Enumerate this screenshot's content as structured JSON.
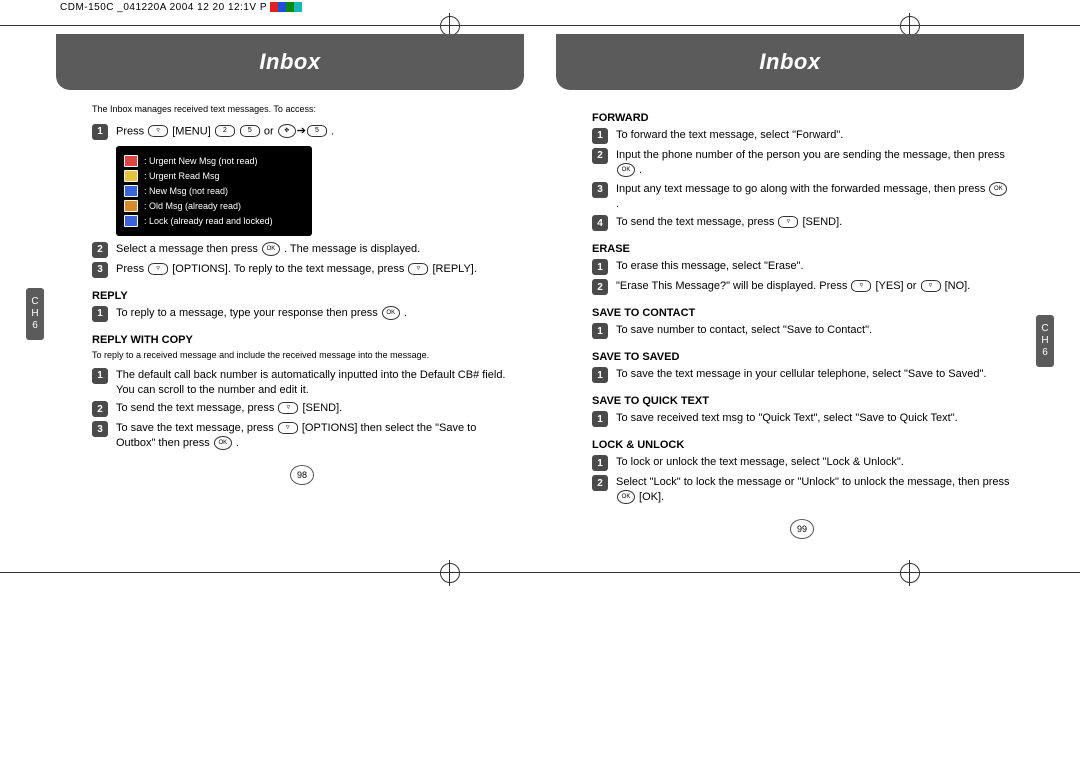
{
  "doc_header": "CDM-150C _041220A  2004 12 20  12:1V  P",
  "left": {
    "title": "Inbox",
    "intro": "The Inbox manages received text messages. To access:",
    "step1_a": "Press ",
    "step1_b": " [MENU] ",
    "step1_c": " or ",
    "step1_d": " .",
    "legend": {
      "l1": ": Urgent New Msg (not read)",
      "l2": ": Urgent Read Msg",
      "l3": ": New Msg (not read)",
      "l4": ": Old Msg (already read)",
      "l5": ": Lock (already read and locked)"
    },
    "step2": "Select a message then press ",
    "step2b": " . The message is displayed.",
    "step3": "Press ",
    "step3b": " [OPTIONS]. To reply to the text message, press ",
    "step3c": " [REPLY].",
    "reply_title": "REPLY",
    "reply_1a": "To reply to a message, type your response then press ",
    "reply_1b": " .",
    "rwc_title": "REPLY WITH COPY",
    "rwc_note": "To reply to a received message and include the received message into the message.",
    "rwc_1": "The default call back number is automatically inputted into the Default CB# field. You can scroll to the number and edit it.",
    "rwc_2a": "To send the text message, press ",
    "rwc_2b": " [SEND].",
    "rwc_3a": "To save the text message, press ",
    "rwc_3b": " [OPTIONS] then select the \"Save to Outbox\" then press ",
    "rwc_3c": " .",
    "side": "C\nH\n6",
    "page": "98"
  },
  "right": {
    "title": "Inbox",
    "fwd_title": "FORWARD",
    "fwd_1": "To forward the text message, select \"Forward\".",
    "fwd_2a": "Input the phone number of the person you are sending the message, then press ",
    "fwd_2b": " .",
    "fwd_3a": "Input any text message to go along with the forwarded message, then press ",
    "fwd_3b": " .",
    "fwd_4a": "To send the text message, press ",
    "fwd_4b": " [SEND].",
    "erase_title": "ERASE",
    "erase_1": "To erase this message, select \"Erase\".",
    "erase_2a": "\"Erase This Message?\" will be displayed. Press ",
    "erase_2b": " [YES] or ",
    "erase_2c": " [NO].",
    "stc_title": "SAVE TO CONTACT",
    "stc_1": "To save number to contact, select \"Save to Contact\".",
    "sts_title": "SAVE TO SAVED",
    "sts_1": "To save the text message in your cellular telephone, select \"Save to Saved\".",
    "stq_title": "SAVE TO QUICK TEXT",
    "stq_1": "To save received text msg to \"Quick Text\", select \"Save to Quick Text\".",
    "lock_title": "LOCK & UNLOCK",
    "lock_1": "To lock or unlock the text message, select \"Lock & Unlock\".",
    "lock_2a": "Select \"Lock\" to lock the message or \"Unlock\" to unlock the message, then press ",
    "lock_2b": " [OK].",
    "side": "C\nH\n6",
    "page": "99"
  },
  "keys": {
    "ok": "OK",
    "n2": "2",
    "n5": "5"
  }
}
